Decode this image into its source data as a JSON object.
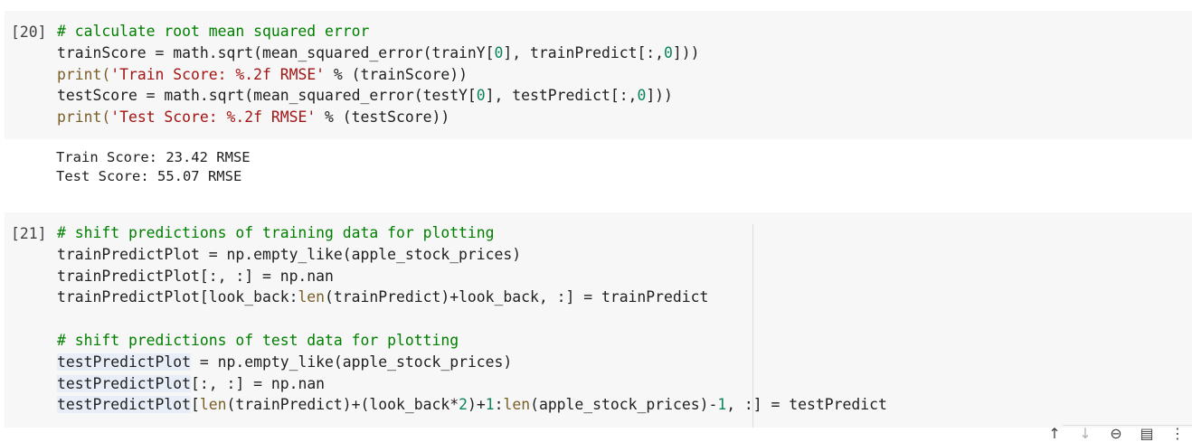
{
  "cell1": {
    "prompt": "[20]",
    "lines": [
      [
        {
          "t": "# calculate root mean squared error",
          "c": "cm"
        }
      ],
      [
        {
          "t": "trainScore = math.sqrt(mean_squared_error(trainY["
        },
        {
          "t": "0",
          "c": "num"
        },
        {
          "t": "], trainPredict[:,"
        },
        {
          "t": "0",
          "c": "num"
        },
        {
          "t": "]))"
        }
      ],
      [
        {
          "t": "print(",
          "c": "op"
        },
        {
          "t": "'Train Score: %.2f RMSE'",
          "c": "str"
        },
        {
          "t": " % (trainScore))"
        }
      ],
      [
        {
          "t": "testScore = math.sqrt(mean_squared_error(testY["
        },
        {
          "t": "0",
          "c": "num"
        },
        {
          "t": "], testPredict[:,"
        },
        {
          "t": "0",
          "c": "num"
        },
        {
          "t": "]))"
        }
      ],
      [
        {
          "t": "print(",
          "c": "op"
        },
        {
          "t": "'Test Score: %.2f RMSE'",
          "c": "str"
        },
        {
          "t": " % (testScore))"
        }
      ]
    ],
    "output": [
      "Train Score: 23.42 RMSE",
      "Test Score: 55.07 RMSE"
    ]
  },
  "cell2": {
    "prompt": "[21]",
    "lines": [
      [
        {
          "t": "# shift predictions of training data for plotting",
          "c": "cm"
        }
      ],
      [
        {
          "t": "trainPredictPlot = np.empty_like(apple_stock_prices)"
        }
      ],
      [
        {
          "t": "trainPredictPlot[:, :] = np.nan"
        }
      ],
      [
        {
          "t": "trainPredictPlot[look_back:"
        },
        {
          "t": "len",
          "c": "bi"
        },
        {
          "t": "(trainPredict)+look_back, :] = trainPredict"
        }
      ],
      [
        {
          "t": ""
        }
      ],
      [
        {
          "t": "# shift predictions of test data for plotting",
          "c": "cm"
        }
      ],
      [
        {
          "t": "testPredictPlot",
          "c": "hl"
        },
        {
          "t": " = np.empty_like(apple_stock_prices)"
        }
      ],
      [
        {
          "t": "testPredictPlot",
          "c": "hl"
        },
        {
          "t": "[:, :] = np.nan"
        }
      ],
      [
        {
          "t": "testPredictPlot",
          "c": "hl"
        },
        {
          "t": "["
        },
        {
          "t": "len",
          "c": "bi"
        },
        {
          "t": "(trainPredict)+(look_back*"
        },
        {
          "t": "2",
          "c": "num"
        },
        {
          "t": ")+"
        },
        {
          "t": "1",
          "c": "num"
        },
        {
          "t": ":"
        },
        {
          "t": "len",
          "c": "bi"
        },
        {
          "t": "(apple_stock_prices)-"
        },
        {
          "t": "1",
          "c": "num"
        },
        {
          "t": ", :] = testPredict"
        }
      ]
    ]
  },
  "toolbar": {
    "up_icon": "↑",
    "down_icon": "↓",
    "link_icon": "⊖",
    "comment_icon": "▤",
    "more_icon": "⋮"
  }
}
